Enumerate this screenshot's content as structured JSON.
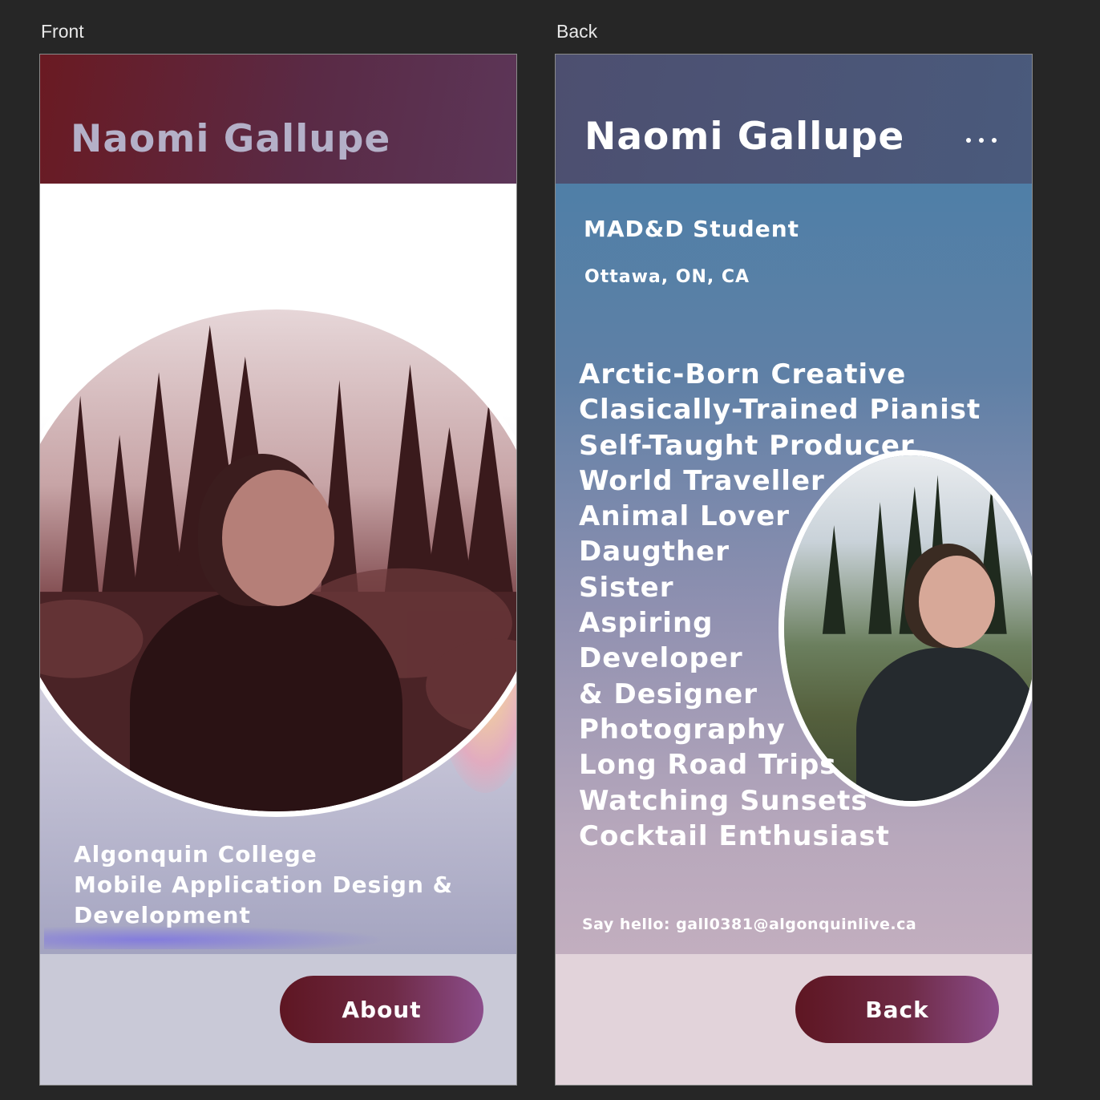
{
  "frames": {
    "front_label": "Front",
    "back_label": "Back"
  },
  "front": {
    "title": "Naomi Gallupe",
    "info_lines": [
      "Algonquin College",
      "Mobile Application Design &",
      "Development"
    ],
    "button_label": "About"
  },
  "back": {
    "title": "Naomi Gallupe",
    "role": "MAD&D Student",
    "location": "Ottawa, ON, CA",
    "traits": [
      "Arctic-Born Creative",
      "Clasically-Trained Pianist",
      "Self-Taught Producer",
      "World Traveller",
      "Animal Lover",
      "Daugther",
      "Sister",
      "Aspiring",
      "Developer",
      "& Designer",
      "Photography",
      "Long Road Trips",
      "Watching Sunsets",
      "Cocktail Enthusiast"
    ],
    "contact": "Say hello: gall0381@algonquinlive.ca",
    "button_label": "Back"
  },
  "colors": {
    "canvas": "#262626",
    "front_header": "#6a1a22",
    "back_header": "#4d4f70",
    "button_gradient_start": "#5e1622",
    "button_gradient_end": "#8c4d8b"
  }
}
